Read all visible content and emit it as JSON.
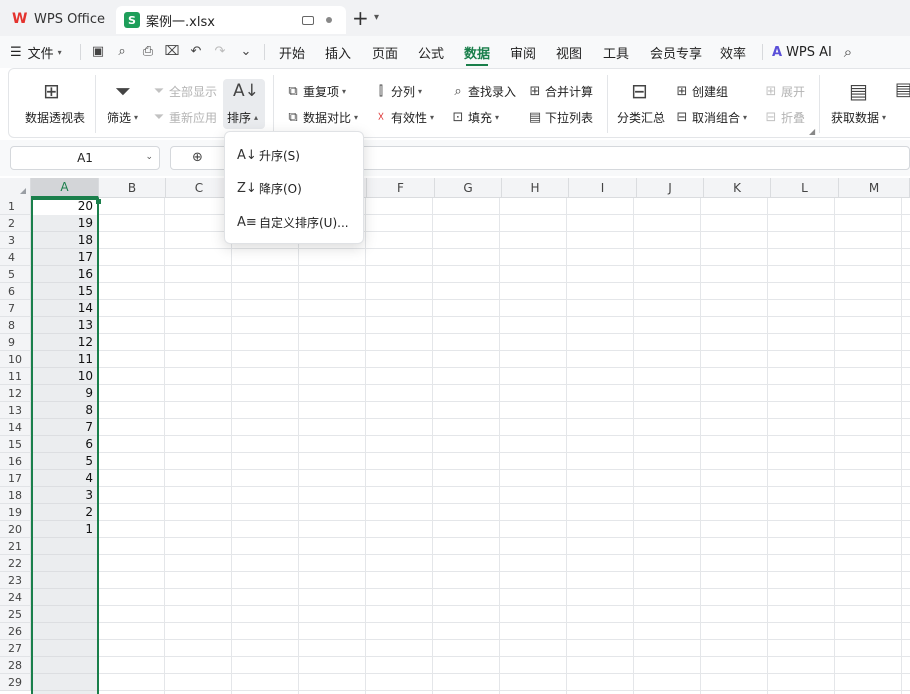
{
  "titlebar": {
    "app_name": "WPS Office",
    "file_tab": "案例一.xlsx",
    "sheet_badge": "S"
  },
  "menubar": {
    "file_label": "文件",
    "tabs": [
      "开始",
      "插入",
      "页面",
      "公式",
      "数据",
      "审阅",
      "视图",
      "工具",
      "会员专享",
      "效率"
    ],
    "active_tab": "数据",
    "wps_ai": "WPS AI"
  },
  "ribbon": {
    "pivot": "数据透视表",
    "filter": "筛选",
    "show_all": "全部显示",
    "reapply": "重新应用",
    "sort": "排序",
    "duplicates": "重复项",
    "compare": "数据对比",
    "split_col": "分列",
    "validity": "有效性",
    "lookup_entry": "查找录入",
    "fill": "填充",
    "consolidate": "合并计算",
    "dropdown_list": "下拉列表",
    "subtotal": "分类汇总",
    "create_group": "创建组",
    "ungroup": "取消组合",
    "expand": "展开",
    "collapse": "折叠",
    "get_data": "获取数据"
  },
  "formulabar": {
    "name_box": "A1"
  },
  "sort_menu": {
    "ascending": "升序(S)",
    "descending": "降序(O)",
    "custom": "自定义排序(U)..."
  },
  "grid": {
    "columns": [
      "A",
      "B",
      "C",
      "D",
      "E",
      "F",
      "G",
      "H",
      "I",
      "J",
      "K",
      "L",
      "M"
    ],
    "selected_column": "A",
    "rows": [
      "1",
      "2",
      "3",
      "4",
      "5",
      "6",
      "7",
      "8",
      "9",
      "10",
      "11",
      "12",
      "13",
      "14",
      "15",
      "16",
      "17",
      "18",
      "19",
      "20",
      "21",
      "22",
      "23",
      "24",
      "25",
      "26",
      "27",
      "28",
      "29"
    ],
    "column_a_values": [
      "20",
      "19",
      "18",
      "17",
      "16",
      "15",
      "14",
      "13",
      "12",
      "11",
      "10",
      "9",
      "8",
      "7",
      "6",
      "5",
      "4",
      "3",
      "2",
      "1"
    ]
  },
  "colors": {
    "accent": "#1a7f4b",
    "wps_red": "#e4332e",
    "sheet_green": "#1e9e5a"
  }
}
